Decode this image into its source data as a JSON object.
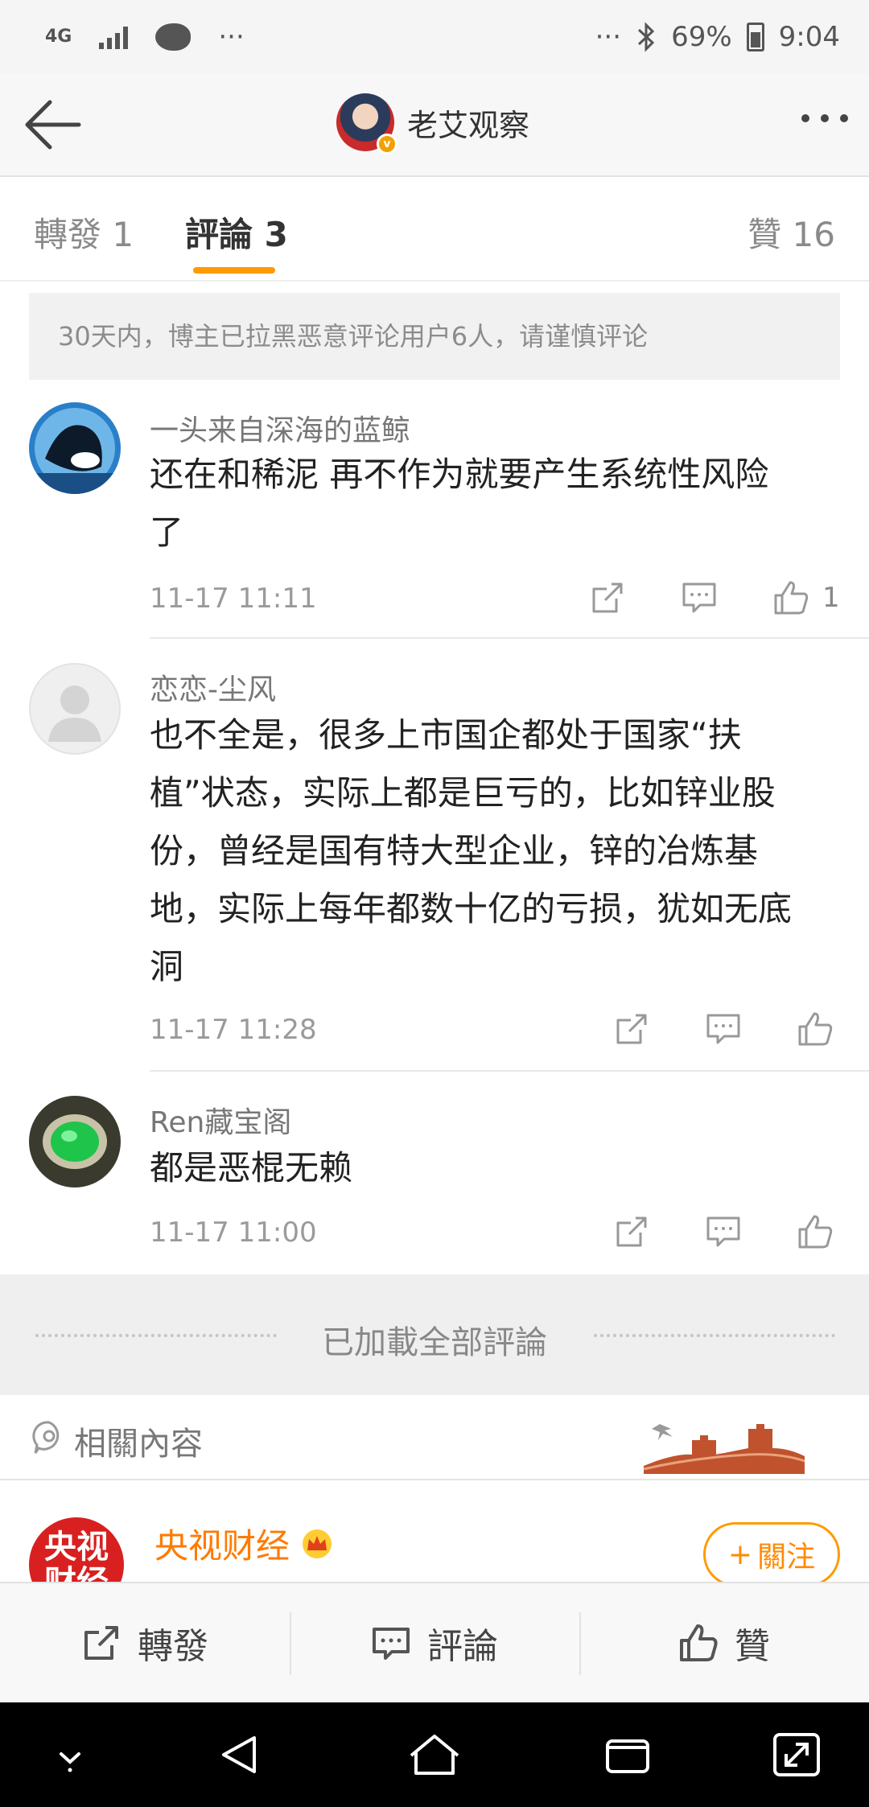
{
  "status_bar": {
    "network": "4G",
    "overflow_left": "···",
    "overflow_right": "···",
    "battery": "69%",
    "time": "9:04",
    "icons": [
      "signal-icon",
      "app-notification-icon",
      "bluetooth-icon",
      "battery-icon"
    ]
  },
  "header": {
    "title": "老艾观察",
    "back_icon": "back-arrow-icon",
    "more_icon": "more-dots-icon"
  },
  "tabs": {
    "repost": "轉發 1",
    "comments": "評論 3",
    "likes": "贊 16",
    "active_color": "#ff9a00"
  },
  "notice": "30天内，博主已拉黑恶意评论用户6人，请谨慎评论",
  "comments": [
    {
      "user": "一头来自深海的蓝鲸",
      "text_lines": [
        "还在和稀泥 再不作为就要产生系统性风险",
        "了"
      ],
      "time": "11-17 11:11",
      "likes": "1"
    },
    {
      "user": "恋恋-尘风",
      "text_lines": [
        "也不全是，很多上市国企都处于国家“扶",
        "植”状态，实际上都是巨亏的，比如锌业股",
        "份，曾经是国有特大型企业，锌的冶炼基",
        "地，实际上每年都数十亿的亏损，犹如无底",
        "洞"
      ],
      "time": "11-17 11:28",
      "likes": ""
    },
    {
      "user": "Ren藏宝阁",
      "text_lines": [
        "都是恶棍无赖"
      ],
      "time": "11-17 11:00",
      "likes": ""
    }
  ],
  "loaded_all": "已加載全部評論",
  "related": {
    "label": "相關內容"
  },
  "recommended": {
    "avatar_text_1": "央视",
    "avatar_text_2": "财经",
    "name": "央视财经",
    "follow": "關注",
    "follow_prefix": "+"
  },
  "action_bar": {
    "repost": "轉發",
    "comment": "評論",
    "like": "贊"
  }
}
